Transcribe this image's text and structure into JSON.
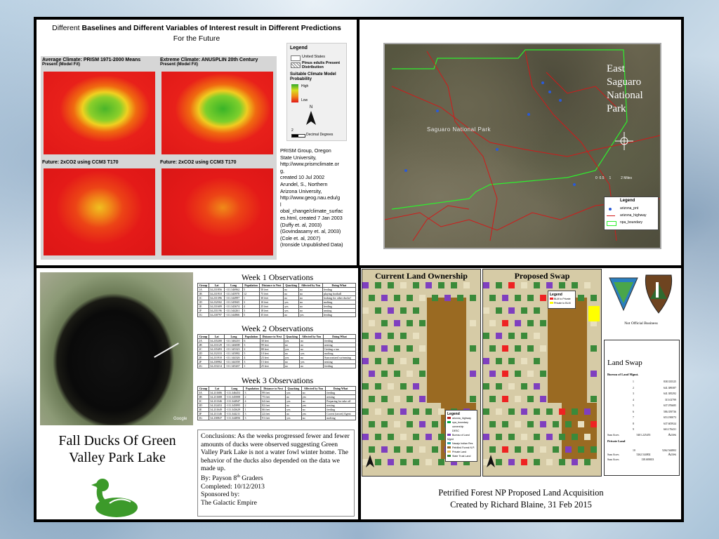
{
  "panel_climate": {
    "title_prefix": "Different",
    "title_bold": "Baselines and Different Variables of Interest result in Different Predictions",
    "subtitle": "For the Future",
    "map1_title": "Average Climate: PRISM 1971-2000 Means",
    "map1_sub": "Present (Model Fit)",
    "map2_title": "Extreme Climate: ANUSPLIN 20th Century",
    "map2_sub": "Present (Model Fit)",
    "map3_title": "Future: 2xCO2 using CCM3 T170",
    "map4_title": "Future: 2xCO2 using CCM3 T170",
    "legend_title": "Legend",
    "legend_us": "United States",
    "legend_pinus": "Pinus edulis Present Distribution",
    "legend_model": "Suitable Climate Model Probability",
    "legend_high": "High",
    "legend_low": "Low",
    "north": "N",
    "scale_label": "Decimal Degrees",
    "scale_num": "2",
    "citation": [
      "PRISM Group, Oregon",
      "State University,",
      "http://www.prismclimate.or",
      "g,",
      "created 10 Jul 2002",
      "Arundel, S., Northern",
      "Arizona University,",
      "http://www.geog.nau.edu/g",
      "l",
      "obal_change/climate_surfac",
      "es.html, created 7 Jan 2003",
      "(Duffy et. al, 2003)",
      "(Govindasamy et. al, 2003)",
      "(Cole et. al, 2007)",
      "(Ironside Unpublished Data)"
    ]
  },
  "panel_saguaro": {
    "park_title": [
      "East",
      "Saguaro",
      "National",
      "Park"
    ],
    "park_label": "Saguaro National Park",
    "legend_title": "Legend",
    "legend_items": [
      "arizona_pnt",
      "arizona_highway",
      "npa_boundary"
    ],
    "scale": "0  0.5     1          2 Miles"
  },
  "panel_ducks": {
    "week1_title": "Week 1 Observations",
    "week2_title": "Week 2 Observations",
    "week3_title": "Week 3 Observations",
    "headers": [
      "Group",
      "Lat",
      "Long",
      "Population",
      "Distance to Nest",
      "Quacking",
      "Affected by You",
      "Doing What"
    ],
    "week1_rows": [
      [
        "1A",
        "34.231856",
        "-111.346962",
        "5",
        "50 feet",
        "no",
        "no",
        "feeding"
      ],
      [
        "1B",
        "34.231910",
        "-111.345970",
        "12",
        "75 feet",
        "no",
        "no",
        "playing football"
      ],
      [
        "1C",
        "34.231396",
        "-111.344997",
        "1",
        "30 feet",
        "no",
        "no",
        "looking for other ducks?"
      ],
      [
        "1D",
        "34.232502",
        "-111.345845",
        "3",
        "10 feet",
        "yes",
        "no",
        "molting"
      ],
      [
        "1E",
        "34.231609",
        "-111.343674",
        "4",
        "25 feet",
        "yes",
        "no",
        "feeding"
      ],
      [
        "1F",
        "34.231196",
        "-111.344261",
        "3",
        "18 feet",
        "yes",
        "no",
        "nesting"
      ],
      [
        "1G",
        "34.230797",
        "-111.344866",
        "5",
        "35 feet",
        "no",
        "yes",
        "feeding"
      ]
    ],
    "week2_rows": [
      [
        "2A",
        "34.235200",
        "-111.346210",
        "6",
        "30 feet",
        "yes",
        "no",
        "feeding"
      ],
      [
        "2B",
        "34.233129",
        "-111.346008",
        "3",
        "99 feet",
        "no",
        "no",
        "nesting"
      ],
      [
        "2C",
        "34.235493",
        "-111.345323",
        "2",
        "88 feet",
        "yes",
        "no",
        "Getting a tan"
      ],
      [
        "2D",
        "34.232333",
        "-111.345882",
        "5",
        "10 feet",
        "no",
        "yes",
        "molting"
      ],
      [
        "2E",
        "34.231910",
        "-111.344326",
        "4",
        "23 feet",
        "yes",
        "no",
        "Syncronized swimming"
      ],
      [
        "2F",
        "34.230982",
        "-111.344358",
        "3",
        "15 feet",
        "no",
        "yes",
        "nesting"
      ],
      [
        "2G",
        "34.233214",
        "-111.345267",
        "1",
        "25 feet",
        "no",
        "no",
        "feeding"
      ]
    ],
    "week3_rows": [
      [
        "3A",
        "34.231686",
        "-111.346453",
        "3",
        "99 feet",
        "yes",
        "no",
        "feeding"
      ],
      [
        "3B",
        "34.231688",
        "-111.345008",
        "2",
        "75 feet",
        "no",
        "yes",
        "nesting"
      ],
      [
        "3C",
        "34.231346",
        "-111.344947",
        "4",
        "64 feet",
        "yes",
        "no",
        "Preparing for take off"
      ],
      [
        "3D",
        "34.232452",
        "-111.345895",
        "2",
        "82 feet",
        "no",
        "yes",
        "nesting"
      ],
      [
        "3E",
        "34.231649",
        "-111.343629",
        "1",
        "66 feet",
        "yes",
        "no",
        "feeding"
      ],
      [
        "3F",
        "34.231146",
        "-111.344211",
        "3",
        "22 feet",
        "no",
        "yes",
        "Covert (secret) Agent"
      ],
      [
        "3G",
        "34.230847",
        "-111.344856",
        "3",
        "91 feet",
        "yes",
        "no",
        "molting"
      ]
    ],
    "poster_title": "Fall Ducks Of Green Valley Park Lake",
    "conclusions": "Conclusions: As the weeks progressed fewer and fewer amounts of ducks were observed suggesting Green Valley Park Lake is not a water fowl winter home. The behavior of the ducks also depended on the data we made up.",
    "by_prefix": "By: Payson 8",
    "by_sup": "th",
    "by_suffix": " Graders",
    "completed": "Completed: 10/12/2013",
    "sponsored": "Sponsored by:",
    "sponsor": "The Galactic Empire",
    "map_watermark": "Google"
  },
  "panel_land": {
    "current_title": "Current Land Ownership",
    "proposed_title": "Proposed Swap",
    "legend_title": "Legend",
    "legend_items": [
      "arizona_highway",
      "npa_boundary",
      "ownership",
      "DESC",
      "Bureau of Land Mgmt",
      "Navajo Indian Res",
      "Petrified Forest N.P.",
      "Private Land",
      "State Trust Land"
    ],
    "legend_colors": [
      "#b41e1e",
      "#00aa44",
      "#ffffff",
      "#ffffff",
      "#7f3fbf",
      "#2aa6a6",
      "#9a6a22",
      "#e8c060",
      "#3a8a3a"
    ],
    "swap_legend_title": "Legend",
    "swap_legend_items": [
      "BLM to Private",
      "Private to BLM"
    ],
    "swap_colors": [
      "#e22",
      "#ff0"
    ],
    "logos_caption": "Not Official Business",
    "land_swap_title": "Land Swap",
    "blm_label": "Bureau of Land Mgmt.",
    "blm_rows": [
      [
        "1",
        "838.335525"
      ],
      [
        "2",
        "641.389387"
      ],
      [
        "3",
        "641.385292"
      ],
      [
        "4",
        "315.02799"
      ],
      [
        "5",
        "637.076685"
      ],
      [
        "6",
        "586.359736"
      ],
      [
        "7",
        "653.190073"
      ],
      [
        "8",
        "637.605924"
      ],
      [
        "9",
        "663.176431"
      ]
    ],
    "sum_label1": "Sum Acres",
    "sum_value1": "5401.225455",
    "acres_label1": "Acres",
    "private_label": "Private Land",
    "private_rows": [
      [
        "10",
        "5262.544802"
      ]
    ],
    "sum_label2": "Sum Acres",
    "sum_value2": "5262.544802",
    "acres_label2": "Acres",
    "diff_label": "Sum Acres",
    "diff_value": "138.680653",
    "caption_line1": "Petrified Forest NP Proposed Land Acquisition",
    "caption_line2": "Created by Richard Blaine, 31 Feb 2015"
  }
}
